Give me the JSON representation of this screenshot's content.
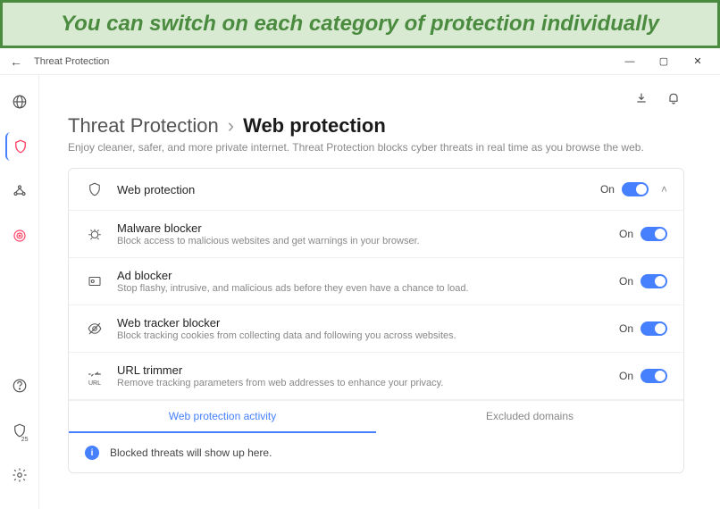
{
  "banner": {
    "text": "You can switch on each category of protection individually"
  },
  "window": {
    "title": "Threat Protection"
  },
  "header": {
    "breadcrumb_parent": "Threat Protection",
    "breadcrumb_sep": "›",
    "breadcrumb_current": "Web protection",
    "subtitle": "Enjoy cleaner, safer, and more private internet. Threat Protection blocks cyber threats in real time as you browse the web."
  },
  "rows": {
    "web_protection": {
      "title": "Web protection",
      "toggle": "On"
    },
    "malware": {
      "title": "Malware blocker",
      "desc": "Block access to malicious websites and get warnings in your browser.",
      "toggle": "On"
    },
    "ad": {
      "title": "Ad blocker",
      "desc": "Stop flashy, intrusive, and malicious ads before they even have a chance to load.",
      "toggle": "On"
    },
    "tracker": {
      "title": "Web tracker blocker",
      "desc": "Block tracking cookies from collecting data and following you across websites.",
      "toggle": "On"
    },
    "url": {
      "title": "URL trimmer",
      "desc": "Remove tracking parameters from web addresses to enhance your privacy.",
      "toggle": "On",
      "icon_label": "URL"
    }
  },
  "tabs": {
    "activity": "Web protection activity",
    "excluded": "Excluded domains"
  },
  "activity": {
    "empty": "Blocked threats will show up here."
  },
  "sidebar": {
    "shield_badge": "25"
  }
}
